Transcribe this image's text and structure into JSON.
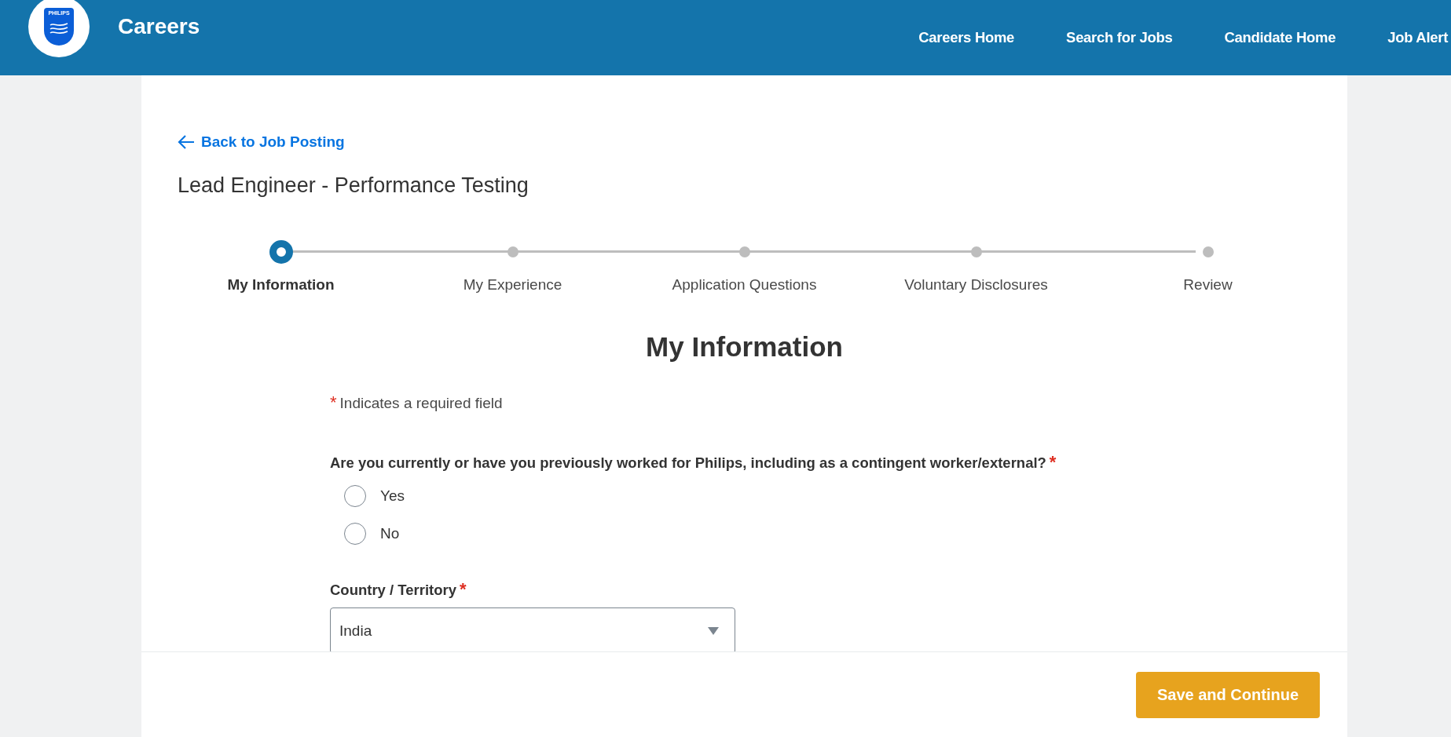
{
  "header": {
    "logo_text": "PHILIPS",
    "title": "Careers",
    "nav": [
      {
        "label": "Careers Home"
      },
      {
        "label": "Search for Jobs"
      },
      {
        "label": "Candidate Home"
      },
      {
        "label": "Job Alert"
      }
    ]
  },
  "back_link": "Back to Job Posting",
  "job_title": "Lead Engineer - Performance Testing",
  "steps": [
    {
      "label": "My Information",
      "selected": true
    },
    {
      "label": "My Experience",
      "selected": false
    },
    {
      "label": "Application Questions",
      "selected": false
    },
    {
      "label": "Voluntary Disclosures",
      "selected": false
    },
    {
      "label": "Review",
      "selected": false
    }
  ],
  "section_title": "My Information",
  "required_note": {
    "mark": "*",
    "text": "Indicates a required field"
  },
  "question": {
    "label": "Are you currently or have you previously worked for Philips, including as a contingent worker/external?",
    "mark": "*",
    "options": [
      {
        "label": "Yes",
        "selected": false
      },
      {
        "label": "No",
        "selected": false
      }
    ]
  },
  "country": {
    "label": "Country / Territory",
    "mark": "*",
    "value": "India"
  },
  "footer": {
    "button": "Save and Continue"
  }
}
